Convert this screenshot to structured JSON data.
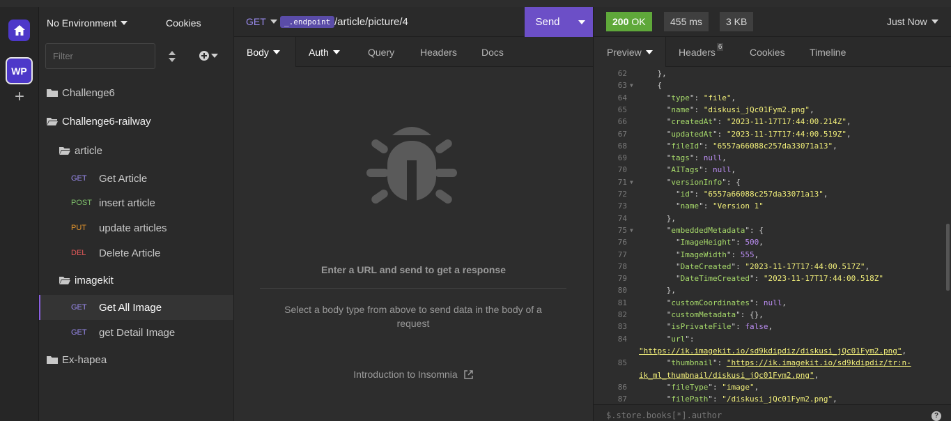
{
  "sidebar": {
    "environment": "No Environment",
    "cookies": "Cookies",
    "filter_placeholder": "Filter",
    "workspace_initials": "WP",
    "tree": [
      {
        "type": "folder",
        "label": "Challenge6",
        "open": false
      },
      {
        "type": "folder",
        "label": "Challenge6-railway",
        "open": true
      },
      {
        "type": "folder",
        "label": "article",
        "open": true
      },
      {
        "type": "request",
        "method": "GET",
        "label": "Get Article"
      },
      {
        "type": "request",
        "method": "POST",
        "label": "insert article"
      },
      {
        "type": "request",
        "method": "PUT",
        "label": "update articles"
      },
      {
        "type": "request",
        "method": "DEL",
        "label": "Delete Article"
      },
      {
        "type": "folder",
        "label": "imagekit",
        "open": true
      },
      {
        "type": "request",
        "method": "GET",
        "label": "Get All Image",
        "active": true
      },
      {
        "type": "request",
        "method": "GET",
        "label": "get Detail Image"
      },
      {
        "type": "folder",
        "label": "Ex-hapea",
        "open": false
      }
    ]
  },
  "request": {
    "method": "GET",
    "endpoint_var": "_.endpoint",
    "path": "/article/picture/4",
    "send_label": "Send",
    "tabs": [
      "Body",
      "Auth",
      "Query",
      "Headers",
      "Docs"
    ],
    "empty_title": "Enter a URL and send to get a response",
    "empty_text": "Select a body type from above to send data in the body of a request",
    "intro_link": "Introduction to Insomnia"
  },
  "response": {
    "status_code": "200",
    "status_text": "OK",
    "time": "455 ms",
    "size": "3 KB",
    "when": "Just Now",
    "tabs": [
      "Preview",
      "Headers",
      "Cookies",
      "Timeline"
    ],
    "headers_count": "6",
    "query_placeholder": "$.store.books[*].author",
    "help": "?",
    "lines": [
      {
        "n": "62",
        "text": "    },"
      },
      {
        "n": "63",
        "text": "    {",
        "fold": true
      },
      {
        "n": "64",
        "key": "type",
        "val": "\"file\"",
        "vtype": "s",
        "indent": 6,
        "tail": ","
      },
      {
        "n": "65",
        "key": "name",
        "val": "\"diskusi_jQc01Fym2.png\"",
        "vtype": "s",
        "indent": 6,
        "tail": ","
      },
      {
        "n": "66",
        "key": "createdAt",
        "val": "\"2023-11-17T17:44:00.214Z\"",
        "vtype": "s",
        "indent": 6,
        "tail": ","
      },
      {
        "n": "67",
        "key": "updatedAt",
        "val": "\"2023-11-17T17:44:00.519Z\"",
        "vtype": "s",
        "indent": 6,
        "tail": ","
      },
      {
        "n": "68",
        "key": "fileId",
        "val": "\"6557a66088c257da33071a13\"",
        "vtype": "s",
        "indent": 6,
        "tail": ","
      },
      {
        "n": "69",
        "key": "tags",
        "val": "null",
        "vtype": "nl",
        "indent": 6,
        "tail": ","
      },
      {
        "n": "70",
        "key": "AITags",
        "val": "null",
        "vtype": "nl",
        "indent": 6,
        "tail": ","
      },
      {
        "n": "71",
        "key": "versionInfo",
        "val": "{",
        "vtype": "p",
        "indent": 6,
        "tail": "",
        "fold": true
      },
      {
        "n": "72",
        "key": "id",
        "val": "\"6557a66088c257da33071a13\"",
        "vtype": "s",
        "indent": 8,
        "tail": ","
      },
      {
        "n": "73",
        "key": "name",
        "val": "\"Version 1\"",
        "vtype": "s",
        "indent": 8,
        "tail": ""
      },
      {
        "n": "74",
        "text": "      },"
      },
      {
        "n": "75",
        "key": "embeddedMetadata",
        "val": "{",
        "vtype": "p",
        "indent": 6,
        "tail": "",
        "fold": true
      },
      {
        "n": "76",
        "key": "ImageHeight",
        "val": "500",
        "vtype": "nl",
        "indent": 8,
        "tail": ","
      },
      {
        "n": "77",
        "key": "ImageWidth",
        "val": "555",
        "vtype": "nl",
        "indent": 8,
        "tail": ","
      },
      {
        "n": "78",
        "key": "DateCreated",
        "val": "\"2023-11-17T17:44:00.517Z\"",
        "vtype": "s",
        "indent": 8,
        "tail": ","
      },
      {
        "n": "79",
        "key": "DateTimeCreated",
        "val": "\"2023-11-17T17:44:00.518Z\"",
        "vtype": "s",
        "indent": 8,
        "tail": ""
      },
      {
        "n": "80",
        "text": "      },"
      },
      {
        "n": "81",
        "key": "customCoordinates",
        "val": "null",
        "vtype": "nl",
        "indent": 6,
        "tail": ","
      },
      {
        "n": "82",
        "key": "customMetadata",
        "val": "{}",
        "vtype": "p",
        "indent": 6,
        "tail": ","
      },
      {
        "n": "83",
        "key": "isPrivateFile",
        "val": "false",
        "vtype": "nl",
        "indent": 6,
        "tail": ","
      },
      {
        "n": "84",
        "key": "url",
        "val": "",
        "vtype": "p",
        "indent": 6,
        "tail": ""
      },
      {
        "n": "",
        "url": "\"https://ik.imagekit.io/sd9kdipdiz/diskusi_jQc01Fym2.png\"",
        "tail": ",",
        "indent": 0
      },
      {
        "n": "85",
        "key": "thumbnail",
        "url": "\"https://ik.imagekit.io/sd9kdipdiz/tr:n-",
        "indent": 6,
        "tail": ""
      },
      {
        "n": "",
        "url": "ik_ml_thumbnail/diskusi_jQc01Fym2.png\"",
        "tail": ",",
        "indent": 0
      },
      {
        "n": "86",
        "key": "fileType",
        "val": "\"image\"",
        "vtype": "s",
        "indent": 6,
        "tail": ","
      },
      {
        "n": "87",
        "key": "filePath",
        "val": "\"/diskusi_jQc01Fym2.png\"",
        "vtype": "s",
        "indent": 6,
        "tail": ","
      }
    ]
  }
}
